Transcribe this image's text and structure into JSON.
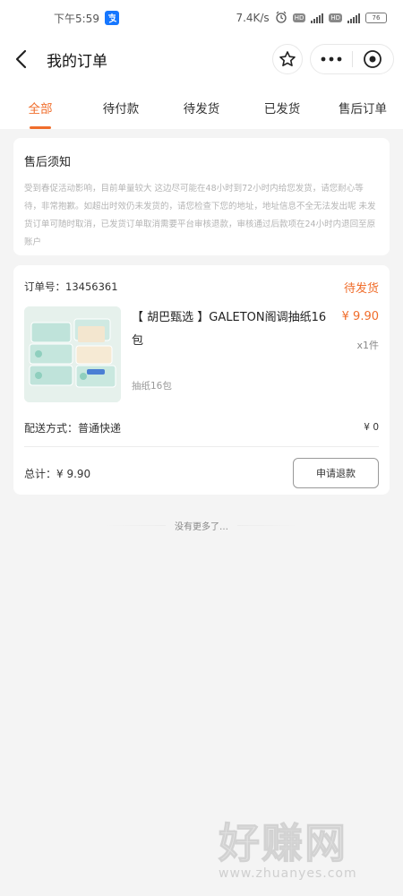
{
  "status_bar": {
    "time": "下午5:59",
    "net_speed": "7.4K/s",
    "hd1": "HD",
    "hd2": "HD",
    "net1": "4G",
    "net2": "4G",
    "battery": "76"
  },
  "nav": {
    "title": "我的订单"
  },
  "tabs": [
    {
      "label": "全部",
      "active": true
    },
    {
      "label": "待付款"
    },
    {
      "label": "待发货"
    },
    {
      "label": "已发货"
    },
    {
      "label": "售后订单"
    }
  ],
  "notice": {
    "title": "售后须知",
    "text": "受到春促活动影响，目前单量较大 这边尽可能在48小时到72小时内给您发货，请您耐心等待，非常抱歉。如超出时效仍未发货的，请您检查下您的地址，地址信息不全无法发出呢 未发货订单可随时取消，已发货订单取消需要平台审核退款，审核通过后款项在24小时内退回至原账户"
  },
  "order": {
    "number_label": "订单号：13456361",
    "status": "待发货",
    "product_title": "【 胡巴甄选 】GALETON阁调抽纸16包",
    "price": "¥ 9.90",
    "quantity": "x1件",
    "spec": "抽纸16包",
    "shipping_label": "配送方式：普通快递",
    "shipping_fee": "¥ 0",
    "total_label": "总计：¥ 9.90",
    "refund_button": "申请退款"
  },
  "footer": {
    "no_more": "没有更多了…"
  },
  "watermark": {
    "brand": "好赚网",
    "url": "www.zhuanyes.com"
  },
  "colors": {
    "accent": "#f06d2b",
    "alipay": "#1677ff"
  }
}
